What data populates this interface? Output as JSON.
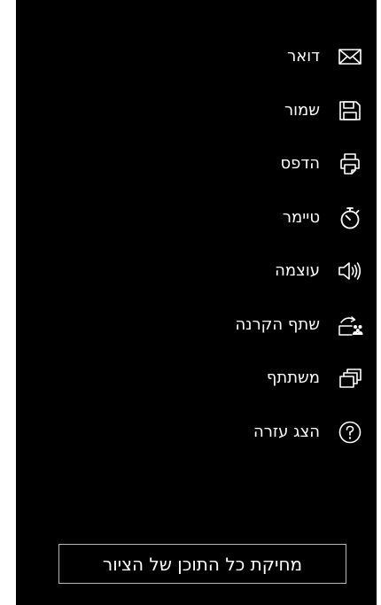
{
  "menu": {
    "items": [
      {
        "label": "דואר",
        "icon": "mail-icon"
      },
      {
        "label": "שמור",
        "icon": "save-icon"
      },
      {
        "label": "הדפס",
        "icon": "print-icon"
      },
      {
        "label": "טיימר",
        "icon": "timer-icon"
      },
      {
        "label": "עוצמה",
        "icon": "volume-icon"
      },
      {
        "label": "שתף הקרנה",
        "icon": "share-projection-icon"
      },
      {
        "label": "משתתף",
        "icon": "participant-icon"
      },
      {
        "label": "הצג עזרה",
        "icon": "help-icon"
      }
    ]
  },
  "actions": {
    "clear_label": "מחיקת כל התוכן של הציור"
  },
  "colors": {
    "background": "#000000",
    "text": "#ffffff",
    "button_border": "#b8b8b8"
  }
}
